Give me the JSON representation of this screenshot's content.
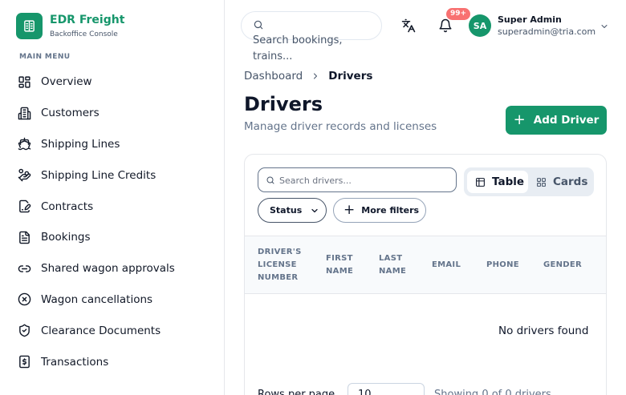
{
  "brand": {
    "title": "EDR Freight",
    "subtitle": "Backoffice Console",
    "color": "#16966b"
  },
  "sidebar": {
    "section_label": "MAIN MENU",
    "items": [
      {
        "label": "Overview",
        "icon": "grid-icon"
      },
      {
        "label": "Customers",
        "icon": "building-icon"
      },
      {
        "label": "Shipping Lines",
        "icon": "ship-icon"
      },
      {
        "label": "Shipping Line Credits",
        "icon": "hand-coins-icon"
      },
      {
        "label": "Contracts",
        "icon": "file-signature-icon"
      },
      {
        "label": "Bookings",
        "icon": "file-text-icon"
      },
      {
        "label": "Shared wagon approvals",
        "icon": "link-icon"
      },
      {
        "label": "Wagon cancellations",
        "icon": "x-circle-icon"
      },
      {
        "label": "Clearance Documents",
        "icon": "shield-check-icon"
      },
      {
        "label": "Transactions",
        "icon": "dollar-receipt-icon"
      }
    ]
  },
  "header": {
    "search_placeholder": "Search bookings, trains...",
    "notification_badge": "99+",
    "user": {
      "initials": "SA",
      "name": "Super Admin",
      "email": "superadmin@tria.com"
    }
  },
  "breadcrumb": {
    "home": "Dashboard",
    "current": "Drivers"
  },
  "page": {
    "title": "Drivers",
    "subtitle": "Manage driver records and licenses",
    "add_button": "Add Driver"
  },
  "toolbar": {
    "search_placeholder": "Search drivers...",
    "view_table": "Table",
    "view_cards": "Cards",
    "status_filter": "Status",
    "more_filters": "More filters"
  },
  "table": {
    "columns": [
      "DRIVER'S LICENSE NUMBER",
      "FIRST NAME",
      "LAST NAME",
      "EMAIL",
      "PHONE",
      "GENDER"
    ],
    "empty_message": "No drivers found"
  },
  "footer": {
    "rows_label": "Rows per page",
    "rows_value": "10",
    "showing": "Showing 0 of 0 drivers"
  }
}
